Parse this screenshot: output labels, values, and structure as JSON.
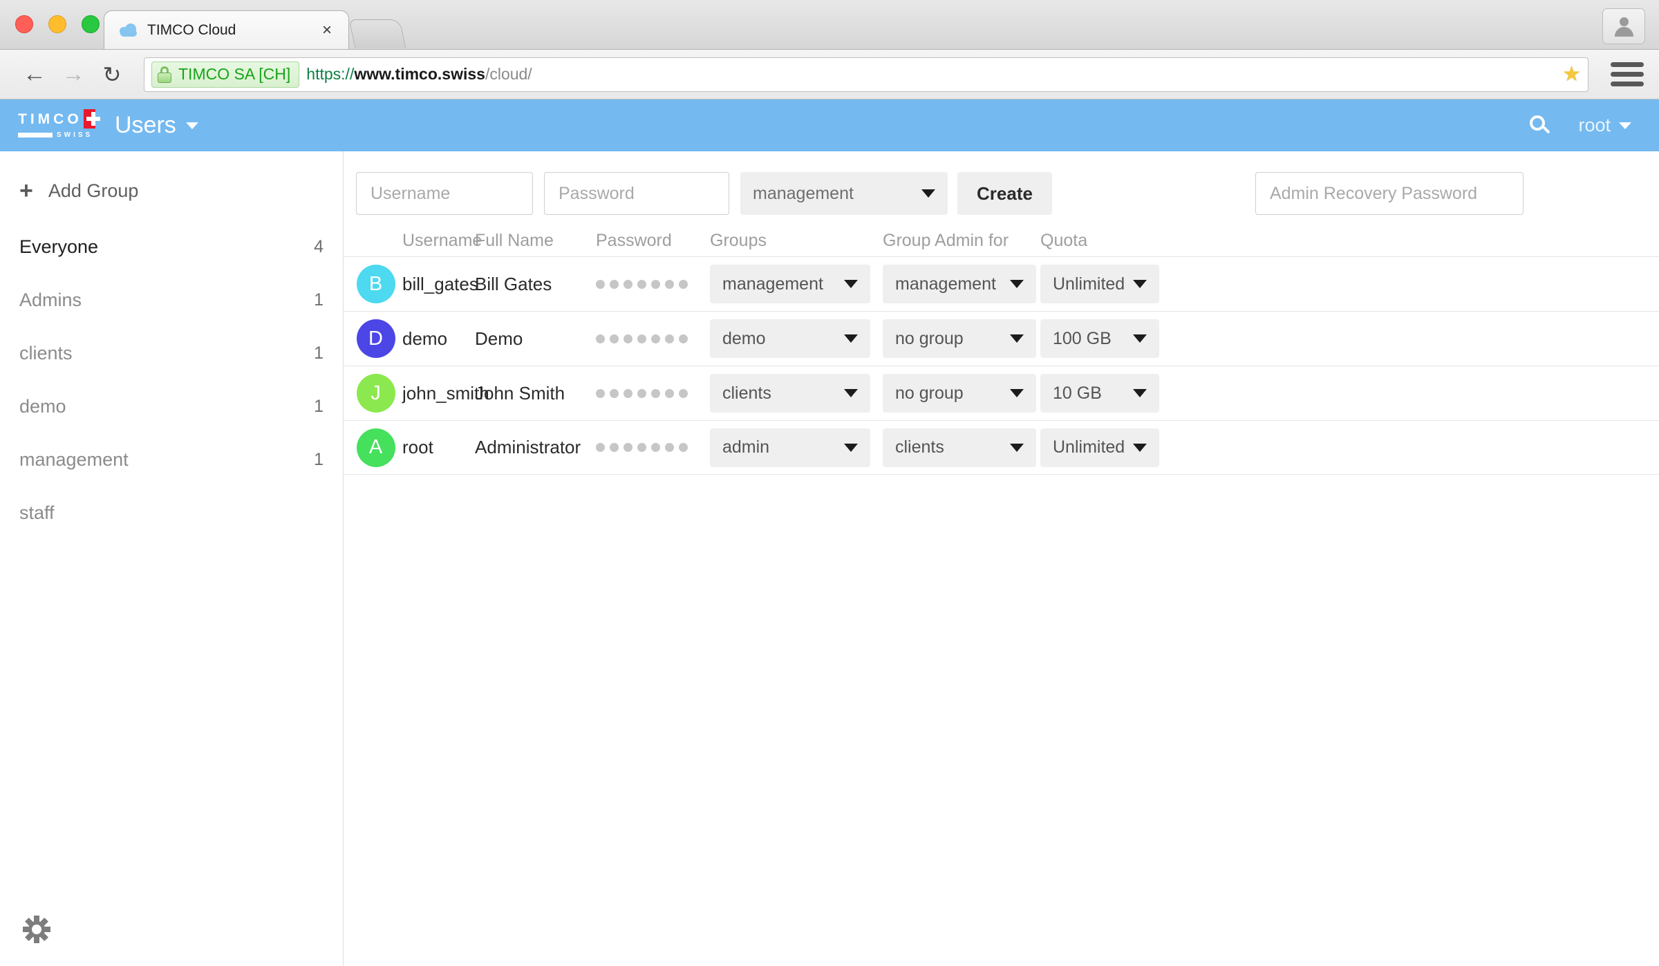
{
  "browser": {
    "tab": {
      "title": "TIMCO Cloud",
      "favicon": "cloud-icon",
      "close_label": "×"
    },
    "new_tab_label": "",
    "nav": {
      "back": "←",
      "forward": "→",
      "reload": "↻"
    },
    "url": {
      "ev_badge": "TIMCO SA [CH]",
      "scheme": "https://",
      "host": "www.timco.swiss",
      "path": "/cloud/"
    },
    "bookmark_star": "★"
  },
  "appbar": {
    "logo_word": "TIMCO",
    "logo_sub": "SWISS",
    "title": "Users",
    "search_icon": "search-icon",
    "user": "root",
    "accent": "#74b9f0"
  },
  "sidebar": {
    "add_group_label": "Add Group",
    "groups": [
      {
        "name": "Everyone",
        "count": "4",
        "active": true
      },
      {
        "name": "Admins",
        "count": "1",
        "active": false
      },
      {
        "name": "clients",
        "count": "1",
        "active": false
      },
      {
        "name": "demo",
        "count": "1",
        "active": false
      },
      {
        "name": "management",
        "count": "1",
        "active": false
      },
      {
        "name": "staff",
        "count": "",
        "active": false
      }
    ],
    "settings_icon": "gear-icon"
  },
  "create_bar": {
    "username_placeholder": "Username",
    "password_placeholder": "Password",
    "group_selected": "management",
    "create_label": "Create",
    "recovery_placeholder": "Admin Recovery Password"
  },
  "table": {
    "headers": {
      "username": "Username",
      "fullname": "Full Name",
      "password": "Password",
      "groups": "Groups",
      "admin": "Group Admin for",
      "quota": "Quota"
    },
    "rows": [
      {
        "initial": "B",
        "avatar_color": "#4dd9f0",
        "username": "bill_gates",
        "fullname": "Bill Gates",
        "password_mask": "●●●●●●●",
        "groups": "management",
        "admin_for": "management",
        "quota": "Unlimited"
      },
      {
        "initial": "D",
        "avatar_color": "#4c46e6",
        "username": "demo",
        "fullname": "Demo",
        "password_mask": "●●●●●●●",
        "groups": "demo",
        "admin_for": "no group",
        "quota": "100 GB"
      },
      {
        "initial": "J",
        "avatar_color": "#8ce84f",
        "username": "john_smith",
        "fullname": "John Smith",
        "password_mask": "●●●●●●●",
        "groups": "clients",
        "admin_for": "no group",
        "quota": "10 GB"
      },
      {
        "initial": "A",
        "avatar_color": "#45e05c",
        "username": "root",
        "fullname": "Administrator",
        "password_mask": "●●●●●●●",
        "groups": "admin",
        "admin_for": "clients",
        "quota": "Unlimited"
      }
    ]
  }
}
